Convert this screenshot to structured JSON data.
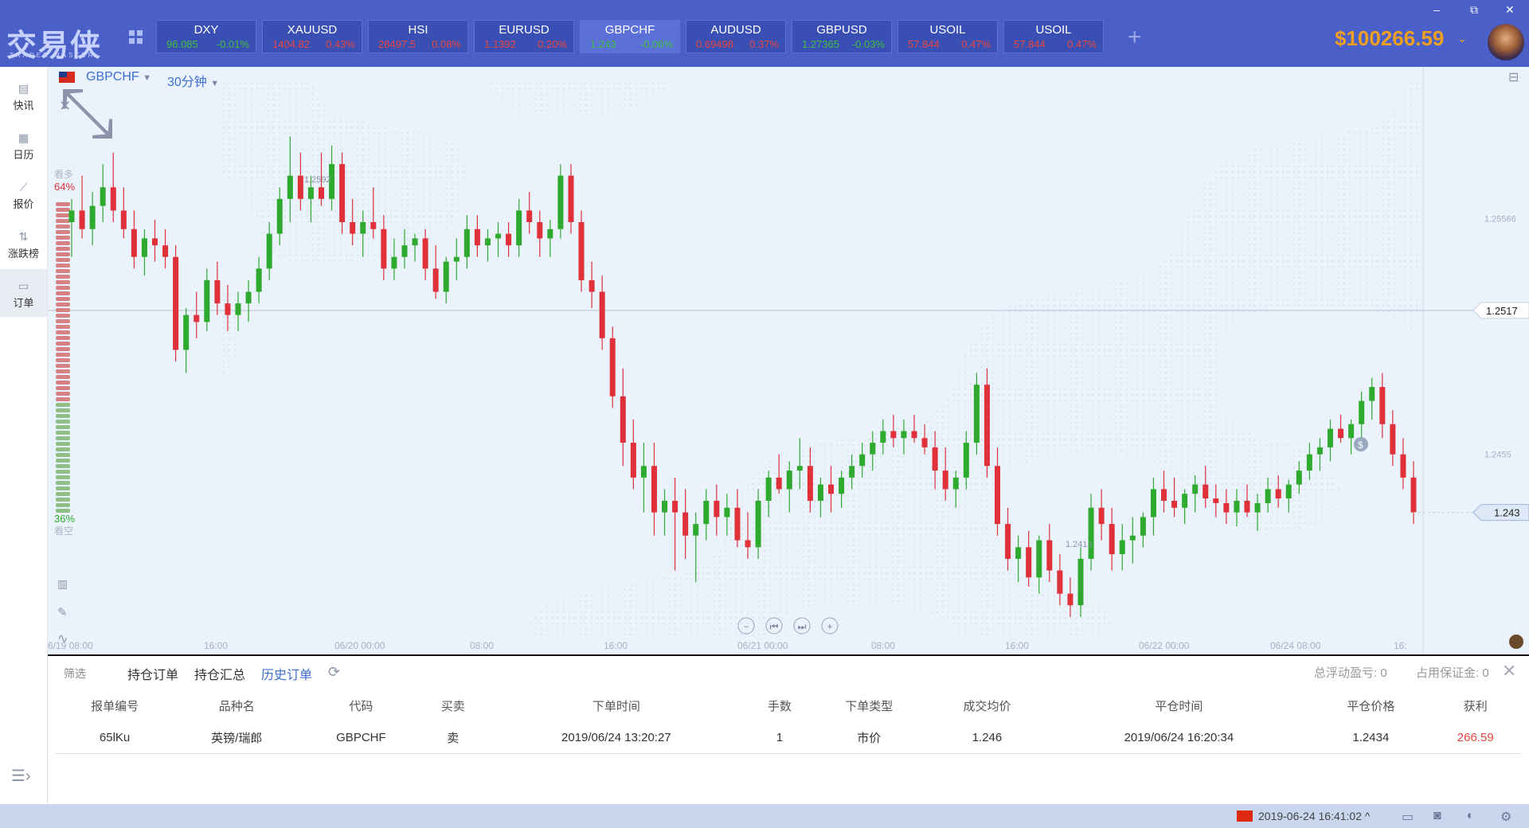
{
  "app": {
    "logo": "交易侠",
    "logo_sub": "TRADER MASTER"
  },
  "window_controls": [
    "–",
    "⧉",
    "✕"
  ],
  "tickers": [
    {
      "symbol": "DXY",
      "price": "96.085",
      "change": "-0.01%",
      "dir": "up"
    },
    {
      "symbol": "XAUUSD",
      "price": "1404.82",
      "change": "0.43%",
      "dir": "dn"
    },
    {
      "symbol": "HSI",
      "price": "28497.5",
      "change": "0.08%",
      "dir": "dn"
    },
    {
      "symbol": "EURUSD",
      "price": "1.1392",
      "change": "0.20%",
      "dir": "dn"
    },
    {
      "symbol": "GBPCHF",
      "price": "1.243",
      "change": "-0.06%",
      "dir": "up"
    },
    {
      "symbol": "AUDUSD",
      "price": "0.69498",
      "change": "0.37%",
      "dir": "dn"
    },
    {
      "symbol": "GBPUSD",
      "price": "1.27365",
      "change": "-0.03%",
      "dir": "up"
    },
    {
      "symbol": "USOIL",
      "price": "57.844",
      "change": "0.47%",
      "dir": "dn"
    },
    {
      "symbol": "USOIL",
      "price": "57.844",
      "change": "0.47%",
      "dir": "dn"
    }
  ],
  "add_symbol": "+",
  "account": {
    "balance": "$100266.59"
  },
  "sidebar": {
    "items": [
      {
        "label": "快讯",
        "icon": "news-icon"
      },
      {
        "label": "日历",
        "icon": "calendar-icon"
      },
      {
        "label": "报价",
        "icon": "quote-icon"
      },
      {
        "label": "涨跌榜",
        "icon": "ranking-icon"
      },
      {
        "label": "订单",
        "icon": "order-icon"
      }
    ]
  },
  "chart_header": {
    "pair": "GBPCHF",
    "timeframe": "30分钟"
  },
  "sentiment": {
    "bull_label": "看多",
    "bull_pct": "64%",
    "bear_label": "看空",
    "bear_pct": "36%",
    "bull_value": 0.64
  },
  "chart_data": {
    "type": "candlestick",
    "symbol": "GBPCHF",
    "x_ticks": [
      "6/19 08:00",
      "16:00",
      "06/20 00:00",
      "08:00",
      "16:00",
      "06/21 00:00",
      "08:00",
      "16:00",
      "06/22 00:00",
      "06/24 08:00",
      "16:"
    ],
    "y_ticks": [
      1.25566,
      1.2517,
      1.2455,
      1.243
    ],
    "current_price": "1.243",
    "crosshair_price": "1.2517",
    "high_label": "1.2592",
    "low_label": "1.2413",
    "y_range": [
      1.2375,
      1.2615
    ],
    "candles": [
      [
        1.2555,
        1.2565,
        1.254,
        1.256
      ],
      [
        1.256,
        1.2575,
        1.2548,
        1.2552
      ],
      [
        1.2552,
        1.2568,
        1.2545,
        1.2562
      ],
      [
        1.2562,
        1.258,
        1.2555,
        1.257
      ],
      [
        1.257,
        1.2585,
        1.2555,
        1.256
      ],
      [
        1.256,
        1.257,
        1.2548,
        1.2552
      ],
      [
        1.2552,
        1.256,
        1.2535,
        1.254
      ],
      [
        1.254,
        1.2552,
        1.2532,
        1.2548
      ],
      [
        1.2548,
        1.2556,
        1.2538,
        1.2545
      ],
      [
        1.2545,
        1.2552,
        1.2535,
        1.254
      ],
      [
        1.254,
        1.2545,
        1.2495,
        1.25
      ],
      [
        1.25,
        1.2518,
        1.249,
        1.2515
      ],
      [
        1.2515,
        1.2525,
        1.2505,
        1.2512
      ],
      [
        1.2512,
        1.2535,
        1.2508,
        1.253
      ],
      [
        1.253,
        1.2538,
        1.2515,
        1.252
      ],
      [
        1.252,
        1.2528,
        1.2508,
        1.2515
      ],
      [
        1.2515,
        1.2525,
        1.2508,
        1.252
      ],
      [
        1.252,
        1.253,
        1.2512,
        1.2525
      ],
      [
        1.2525,
        1.254,
        1.252,
        1.2535
      ],
      [
        1.2535,
        1.2555,
        1.253,
        1.255
      ],
      [
        1.255,
        1.257,
        1.2545,
        1.2565
      ],
      [
        1.2565,
        1.2592,
        1.2555,
        1.2575
      ],
      [
        1.2575,
        1.2585,
        1.256,
        1.2565
      ],
      [
        1.2565,
        1.2575,
        1.2555,
        1.257
      ],
      [
        1.257,
        1.2585,
        1.2562,
        1.2565
      ],
      [
        1.2565,
        1.2588,
        1.256,
        1.258
      ],
      [
        1.258,
        1.2585,
        1.255,
        1.2555
      ],
      [
        1.2555,
        1.2565,
        1.2545,
        1.255
      ],
      [
        1.255,
        1.256,
        1.254,
        1.2555
      ],
      [
        1.2555,
        1.257,
        1.2548,
        1.2552
      ],
      [
        1.2552,
        1.2558,
        1.253,
        1.2535
      ],
      [
        1.2535,
        1.2548,
        1.253,
        1.254
      ],
      [
        1.254,
        1.2552,
        1.2535,
        1.2545
      ],
      [
        1.2545,
        1.255,
        1.2538,
        1.2548
      ],
      [
        1.2548,
        1.2552,
        1.253,
        1.2535
      ],
      [
        1.2535,
        1.2545,
        1.2522,
        1.2525
      ],
      [
        1.2525,
        1.254,
        1.252,
        1.2538
      ],
      [
        1.2538,
        1.2548,
        1.253,
        1.254
      ],
      [
        1.254,
        1.2558,
        1.2535,
        1.2552
      ],
      [
        1.2552,
        1.2558,
        1.254,
        1.2545
      ],
      [
        1.2545,
        1.2552,
        1.2538,
        1.2548
      ],
      [
        1.2548,
        1.2555,
        1.254,
        1.255
      ],
      [
        1.255,
        1.2555,
        1.254,
        1.2545
      ],
      [
        1.2545,
        1.2565,
        1.254,
        1.256
      ],
      [
        1.256,
        1.2568,
        1.255,
        1.2555
      ],
      [
        1.2555,
        1.256,
        1.254,
        1.2548
      ],
      [
        1.2548,
        1.2556,
        1.254,
        1.2552
      ],
      [
        1.2552,
        1.258,
        1.2548,
        1.2575
      ],
      [
        1.2575,
        1.258,
        1.255,
        1.2555
      ],
      [
        1.2555,
        1.256,
        1.2525,
        1.253
      ],
      [
        1.253,
        1.2538,
        1.2518,
        1.2525
      ],
      [
        1.2525,
        1.2532,
        1.25,
        1.2505
      ],
      [
        1.2505,
        1.251,
        1.2475,
        1.248
      ],
      [
        1.248,
        1.2492,
        1.245,
        1.246
      ],
      [
        1.246,
        1.247,
        1.244,
        1.2445
      ],
      [
        1.2445,
        1.246,
        1.243,
        1.245
      ],
      [
        1.245,
        1.246,
        1.242,
        1.243
      ],
      [
        1.243,
        1.244,
        1.242,
        1.2435
      ],
      [
        1.2435,
        1.2445,
        1.2405,
        1.243
      ],
      [
        1.243,
        1.244,
        1.241,
        1.242
      ],
      [
        1.242,
        1.243,
        1.24,
        1.2425
      ],
      [
        1.2425,
        1.244,
        1.2418,
        1.2435
      ],
      [
        1.2435,
        1.2442,
        1.242,
        1.2428
      ],
      [
        1.2428,
        1.2438,
        1.242,
        1.2432
      ],
      [
        1.2432,
        1.244,
        1.2415,
        1.2418
      ],
      [
        1.2418,
        1.243,
        1.241,
        1.2415
      ],
      [
        1.2415,
        1.244,
        1.241,
        1.2435
      ],
      [
        1.2435,
        1.2448,
        1.2428,
        1.2445
      ],
      [
        1.2445,
        1.2455,
        1.2438,
        1.244
      ],
      [
        1.244,
        1.2452,
        1.243,
        1.2448
      ],
      [
        1.2448,
        1.2462,
        1.244,
        1.245
      ],
      [
        1.245,
        1.2458,
        1.243,
        1.2435
      ],
      [
        1.2435,
        1.2445,
        1.2428,
        1.2442
      ],
      [
        1.2442,
        1.245,
        1.243,
        1.2438
      ],
      [
        1.2438,
        1.2448,
        1.2432,
        1.2445
      ],
      [
        1.2445,
        1.2455,
        1.244,
        1.245
      ],
      [
        1.245,
        1.246,
        1.2445,
        1.2455
      ],
      [
        1.2455,
        1.2465,
        1.2448,
        1.246
      ],
      [
        1.246,
        1.247,
        1.2455,
        1.2465
      ],
      [
        1.2465,
        1.2472,
        1.2458,
        1.2462
      ],
      [
        1.2462,
        1.247,
        1.2455,
        1.2465
      ],
      [
        1.2465,
        1.2472,
        1.246,
        1.2462
      ],
      [
        1.2462,
        1.2468,
        1.2455,
        1.2458
      ],
      [
        1.2458,
        1.2465,
        1.244,
        1.2448
      ],
      [
        1.2448,
        1.2458,
        1.2435,
        1.244
      ],
      [
        1.244,
        1.2448,
        1.2432,
        1.2445
      ],
      [
        1.2445,
        1.2465,
        1.244,
        1.246
      ],
      [
        1.246,
        1.249,
        1.2455,
        1.2485
      ],
      [
        1.2485,
        1.2492,
        1.2445,
        1.245
      ],
      [
        1.245,
        1.2458,
        1.242,
        1.2425
      ],
      [
        1.2425,
        1.2432,
        1.2405,
        1.241
      ],
      [
        1.241,
        1.242,
        1.24,
        1.2415
      ],
      [
        1.2415,
        1.2422,
        1.2398,
        1.2402
      ],
      [
        1.2402,
        1.242,
        1.2395,
        1.2418
      ],
      [
        1.2418,
        1.2425,
        1.24,
        1.2405
      ],
      [
        1.2405,
        1.2412,
        1.239,
        1.2395
      ],
      [
        1.2395,
        1.2402,
        1.2385,
        1.239
      ],
      [
        1.239,
        1.2415,
        1.2385,
        1.241
      ],
      [
        1.241,
        1.2438,
        1.2405,
        1.2432
      ],
      [
        1.2432,
        1.244,
        1.2418,
        1.2425
      ],
      [
        1.2425,
        1.2432,
        1.2405,
        1.2412
      ],
      [
        1.2412,
        1.2425,
        1.2405,
        1.2418
      ],
      [
        1.2418,
        1.2428,
        1.2408,
        1.242
      ],
      [
        1.242,
        1.243,
        1.2415,
        1.2428
      ],
      [
        1.2428,
        1.2445,
        1.242,
        1.244
      ],
      [
        1.244,
        1.2448,
        1.243,
        1.2435
      ],
      [
        1.2435,
        1.2445,
        1.2428,
        1.2432
      ],
      [
        1.2432,
        1.244,
        1.2425,
        1.2438
      ],
      [
        1.2438,
        1.2446,
        1.243,
        1.2442
      ],
      [
        1.2442,
        1.245,
        1.2432,
        1.2436
      ],
      [
        1.2436,
        1.2442,
        1.2428,
        1.2434
      ],
      [
        1.2434,
        1.244,
        1.2425,
        1.243
      ],
      [
        1.243,
        1.244,
        1.2424,
        1.2435
      ],
      [
        1.2435,
        1.2442,
        1.2428,
        1.243
      ],
      [
        1.243,
        1.2438,
        1.2422,
        1.2434
      ],
      [
        1.2434,
        1.2445,
        1.243,
        1.244
      ],
      [
        1.244,
        1.2446,
        1.2432,
        1.2436
      ],
      [
        1.2436,
        1.2444,
        1.243,
        1.2442
      ],
      [
        1.2442,
        1.2452,
        1.2438,
        1.2448
      ],
      [
        1.2448,
        1.246,
        1.2444,
        1.2455
      ],
      [
        1.2455,
        1.2462,
        1.2448,
        1.2458
      ],
      [
        1.2458,
        1.247,
        1.2452,
        1.2466
      ],
      [
        1.2466,
        1.2472,
        1.246,
        1.2462
      ],
      [
        1.2462,
        1.247,
        1.2455,
        1.2468
      ],
      [
        1.2468,
        1.2482,
        1.2462,
        1.2478
      ],
      [
        1.2478,
        1.2488,
        1.247,
        1.2484
      ],
      [
        1.2484,
        1.249,
        1.2462,
        1.2468
      ],
      [
        1.2468,
        1.2474,
        1.245,
        1.2455
      ],
      [
        1.2455,
        1.2462,
        1.244,
        1.2445
      ],
      [
        1.2445,
        1.2452,
        1.2425,
        1.243
      ]
    ]
  },
  "chart_tools": [
    "close-icon",
    "collapse-icon",
    "indicator-icon",
    "draw-icon",
    "pulse-icon"
  ],
  "zoom_controls": [
    "−",
    "⏮",
    "⏭",
    "+"
  ],
  "orders_panel": {
    "filter": "筛选",
    "tabs": [
      "持仓订单",
      "持仓汇总",
      "历史订单"
    ],
    "active_tab": 2,
    "floating_pl": "总浮动盈亏: 0",
    "margin": "占用保证金: 0",
    "headers": [
      "报单编号",
      "品种名",
      "代码",
      "买卖",
      "下单时间",
      "手数",
      "下单类型",
      "成交均价",
      "平仓时间",
      "平仓价格",
      "获利"
    ],
    "rows": [
      [
        "65lKu",
        "英镑/瑞郎",
        "GBPCHF",
        "卖",
        "2019/06/24 13:20:27",
        "1",
        "市价",
        "1.246",
        "2019/06/24 16:20:34",
        "1.2434",
        "266.59"
      ]
    ]
  },
  "status_bar": {
    "datetime": "2019-06-24 16:41:02 ^"
  },
  "colors": {
    "up": "#2eaa2e",
    "down": "#e0303a",
    "accent": "#3d6fd1",
    "topbar": "#4a5fc7"
  }
}
